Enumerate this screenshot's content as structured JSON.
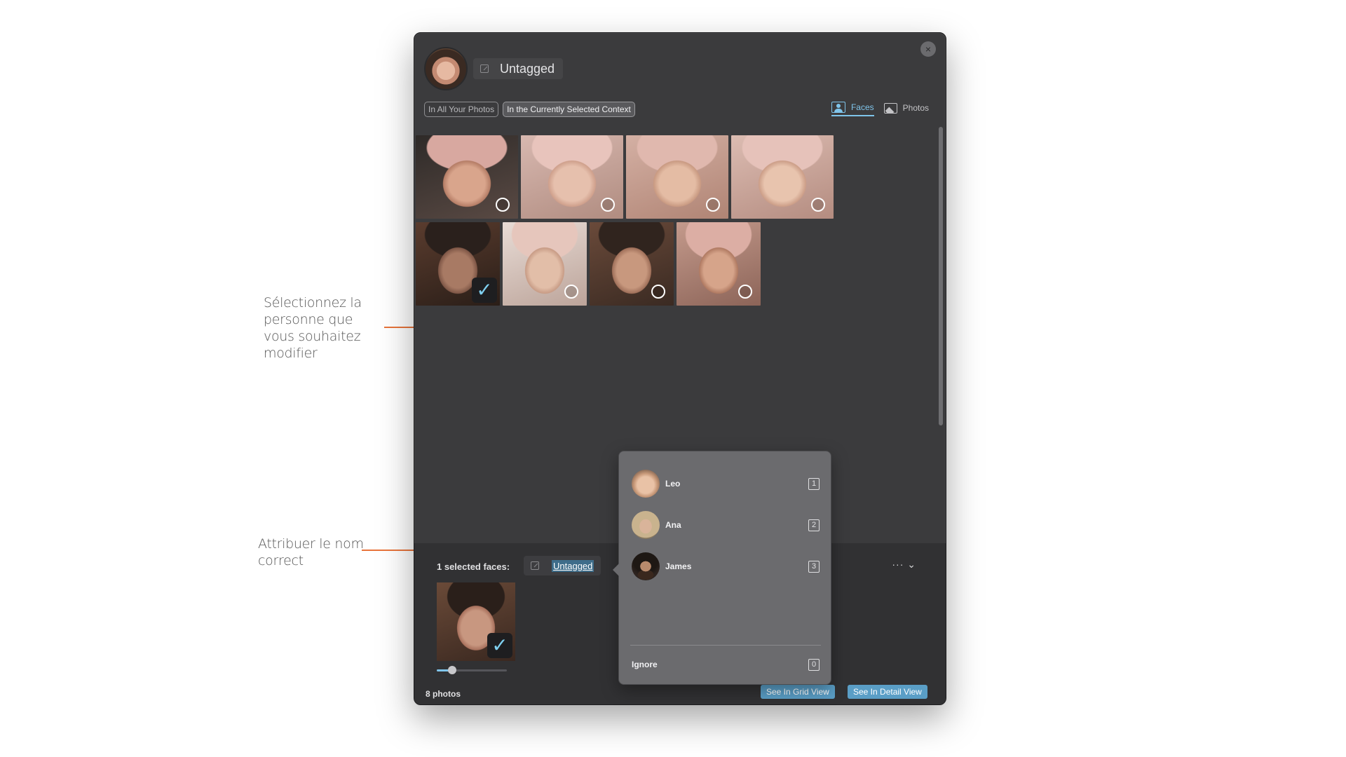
{
  "annotations": {
    "select_person": "Sélectionnez la\npersonne que\nvous souhaitez\nmodifier",
    "assign_name": "Attribuer le nom\ncorrect"
  },
  "header": {
    "name": "Untagged",
    "close_icon": "×"
  },
  "scope": {
    "all_photos": "In All Your Photos",
    "current_context": "In the Currently Selected Context"
  },
  "view_toggle": {
    "faces": "Faces",
    "photos": "Photos"
  },
  "grid": {
    "faces": [
      {
        "selected": false
      },
      {
        "selected": false
      },
      {
        "selected": false
      },
      {
        "selected": false
      },
      {
        "selected": true
      },
      {
        "selected": false
      },
      {
        "selected": false
      },
      {
        "selected": false
      }
    ],
    "check_glyph": "✓"
  },
  "bottom": {
    "selected_label": "1 selected faces:",
    "selected_name": "Untagged",
    "more_label": "··· ⌄",
    "zoom_level": 0.22,
    "photo_count": "8 photos",
    "grid_view_button": "See In Grid View",
    "detail_view_button": "See In Detail View"
  },
  "popover": {
    "people": [
      {
        "name": "Leo",
        "key": "1"
      },
      {
        "name": "Ana",
        "key": "2"
      },
      {
        "name": "James",
        "key": "3"
      }
    ],
    "ignore": {
      "name": "Ignore",
      "key": "0"
    }
  },
  "colors": {
    "accent": "#7fc4ea",
    "annotation": "#e8743b",
    "button": "#5a9ec6"
  }
}
